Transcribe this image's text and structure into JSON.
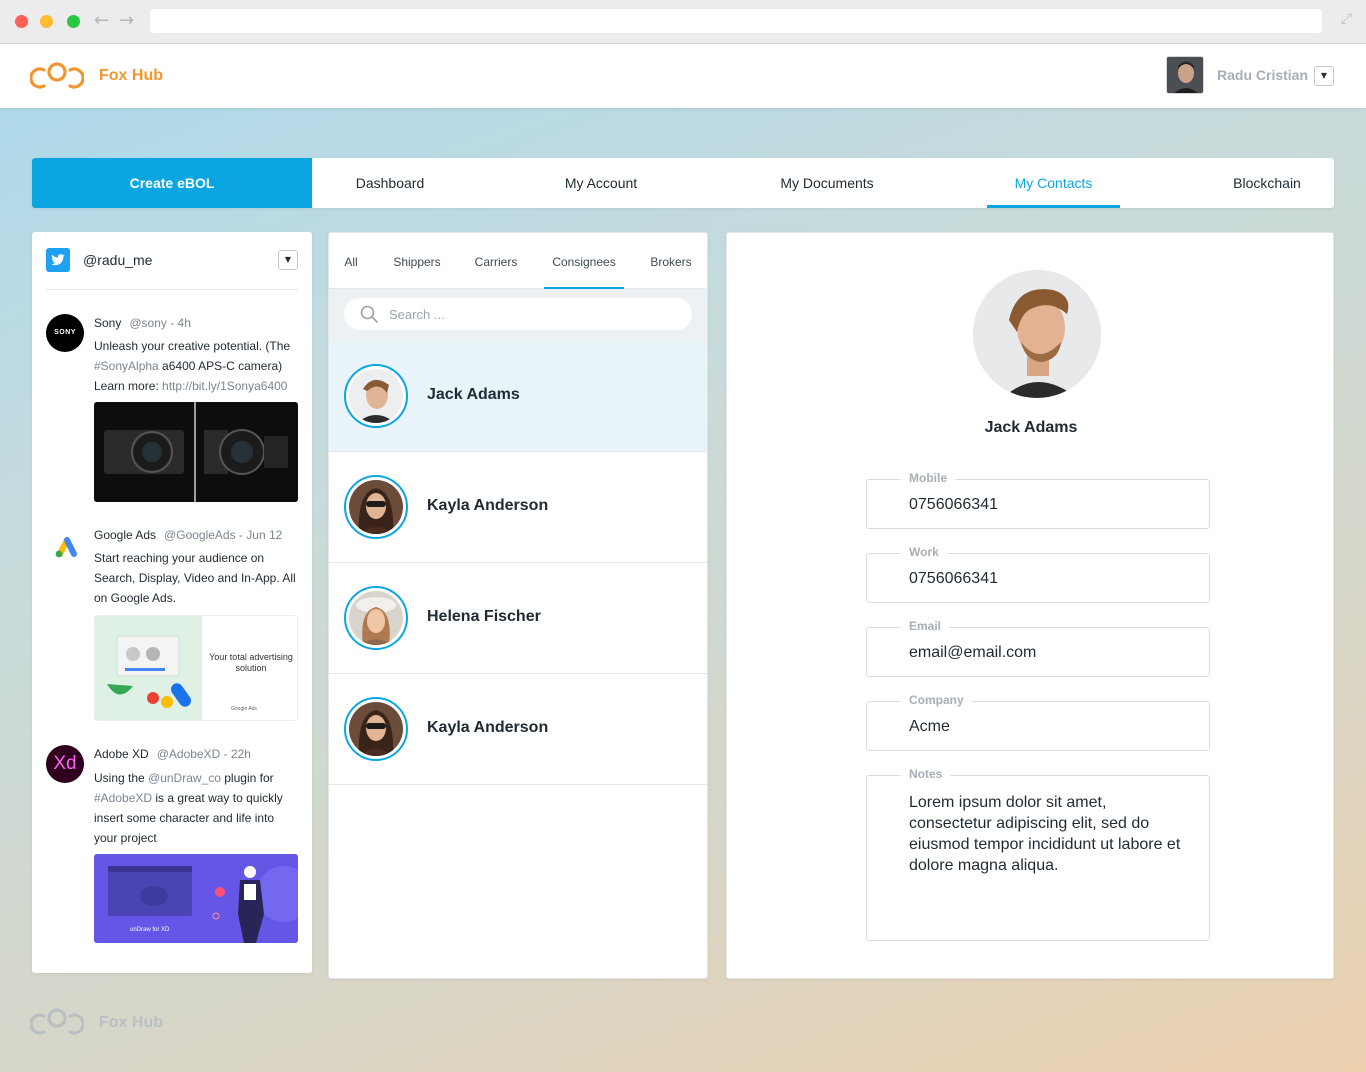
{
  "app": {
    "name": "Fox Hub",
    "footer_name": "Fox Hub",
    "accent": "#0ba6e2",
    "brand_color": "#f0962e"
  },
  "user": {
    "name": "Radu Cristian"
  },
  "nav": {
    "create": "Create eBOL",
    "tabs": [
      "Dashboard",
      "My Account",
      "My Documents",
      "My Contacts",
      "Blockchain"
    ],
    "active": "My Contacts"
  },
  "twitter": {
    "handle": "@radu_me",
    "tweets": [
      {
        "name": "Sony",
        "meta": "@sony - 4h",
        "text_a": "Unleash your creative potential. (The ",
        "hashtag": "#SonyAlpha",
        "text_b": " a6400 APS-C camera) Learn more: ",
        "link": "http://bit.ly/1Sonya6400"
      },
      {
        "name": "Google Ads",
        "meta": "@GoogleAds - Jun 12",
        "text": "Start reaching your audience on Search, Display, Video and In-App. All on Google Ads.",
        "img_caption": "Your total advertising solution",
        "img_logo": "Google Ads"
      },
      {
        "name": "Adobe XD",
        "meta": "@AdobeXD - 22h",
        "text_a": "Using the ",
        "mention": "@unDraw_co",
        "text_b": " plugin for ",
        "hashtag": "#AdobeXD",
        "text_c": " is a great way to quickly insert some character and life into your project",
        "img_caption": "unDraw for XD",
        "avatar_text": "Xd"
      }
    ],
    "sony_logo_text": "SONY"
  },
  "contacts": {
    "filters": [
      "All",
      "Shippers",
      "Carriers",
      "Consignees",
      "Brokers"
    ],
    "active_filter": "Consignees",
    "search_placeholder": "Search ...",
    "list": [
      {
        "name": "Jack Adams",
        "selected": true
      },
      {
        "name": "Kayla Anderson",
        "selected": false
      },
      {
        "name": "Helena Fischer",
        "selected": false
      },
      {
        "name": "Kayla Anderson",
        "selected": false
      }
    ]
  },
  "detail": {
    "name": "Jack Adams",
    "fields": [
      {
        "label": "Mobile",
        "value": "0756066341"
      },
      {
        "label": "Work",
        "value": "0756066341"
      },
      {
        "label": "Email",
        "value": "email@email.com"
      },
      {
        "label": "Company",
        "value": "Acme"
      }
    ],
    "notes_label": "Notes",
    "notes": "Lorem ipsum dolor sit amet, consectetur adipiscing elit, sed do eiusmod tempor incididunt ut labore et dolore magna aliqua."
  }
}
